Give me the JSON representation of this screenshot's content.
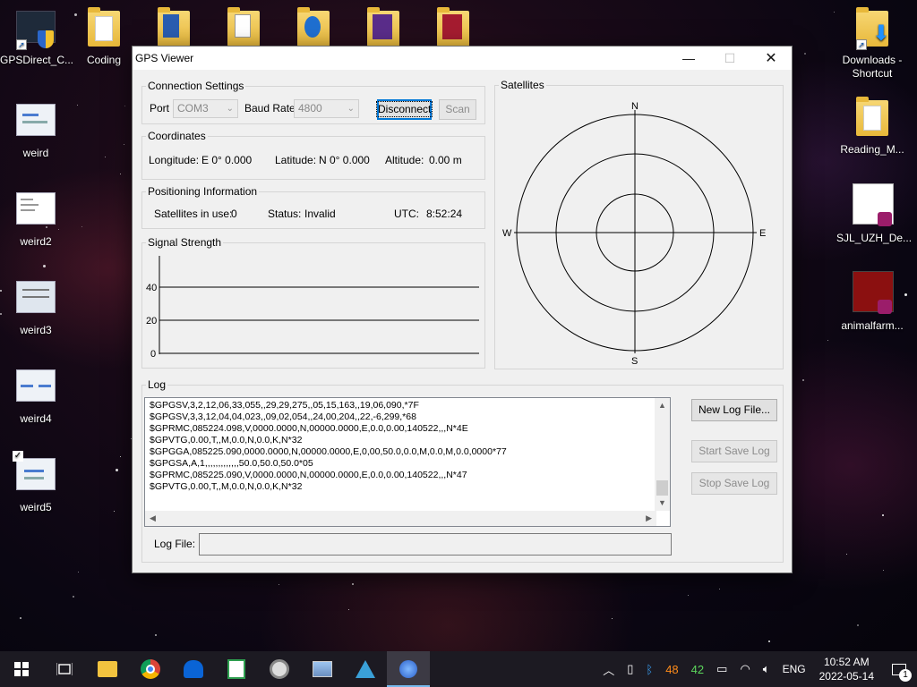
{
  "desktop": {
    "icons_left": [
      {
        "label": "GPSDirect_C...",
        "icon": "shortcut-shield-icon"
      },
      {
        "label": "weird",
        "icon": "image-thumb-icon"
      },
      {
        "label": "weird2",
        "icon": "image-thumb-icon"
      },
      {
        "label": "weird3",
        "icon": "image-thumb-icon"
      },
      {
        "label": "weird4",
        "icon": "image-thumb-icon"
      },
      {
        "label": "weird5",
        "icon": "image-thumb-icon"
      }
    ],
    "icons_top": [
      {
        "label": "Coding",
        "icon": "folder-icon"
      },
      {
        "label": "",
        "icon": "folder-icon"
      },
      {
        "label": "",
        "icon": "folder-icon"
      },
      {
        "label": "",
        "icon": "folder-icon"
      },
      {
        "label": "",
        "icon": "folder-icon"
      },
      {
        "label": "",
        "icon": "folder-icon"
      }
    ],
    "icons_right": [
      {
        "label": "Downloads - Shortcut",
        "icon": "downloads-folder-icon"
      },
      {
        "label": "Reading_M...",
        "icon": "folder-icon"
      },
      {
        "label": "SJL_UZH_De...",
        "icon": "pdf-document-icon"
      },
      {
        "label": "animalfarm...",
        "icon": "pdf-document-icon"
      }
    ]
  },
  "window": {
    "title": "GPS Viewer",
    "connection": {
      "group_label": "Connection Settings",
      "port_label": "Port",
      "port_value": "COM3",
      "baud_label": "Baud Rate",
      "baud_value": "4800",
      "disconnect_label": "Disconnect",
      "scan_label": "Scan"
    },
    "coordinates": {
      "group_label": "Coordinates",
      "longitude_label": "Longitude:",
      "longitude_value": "E 0° 0.000",
      "latitude_label": "Latitude:",
      "latitude_value": "N 0° 0.000",
      "altitude_label": "Altitude:",
      "altitude_value": "0.00 m"
    },
    "positioning": {
      "group_label": "Positioning Information",
      "sats_label": "Satellites in use:",
      "sats_value": "0",
      "status_label": "Status:",
      "status_value": "Invalid",
      "utc_label": "UTC:",
      "utc_value": "8:52:24"
    },
    "signal": {
      "group_label": "Signal Strength",
      "ticks": [
        "40",
        "20",
        "0"
      ]
    },
    "satellites": {
      "group_label": "Satellites",
      "compass": {
        "n": "N",
        "s": "S",
        "e": "E",
        "w": "W"
      }
    },
    "log": {
      "group_label": "Log",
      "lines": [
        "$GPGSV,3,2,12,06,33,055,,29,29,275,,05,15,163,,19,06,090,*7F",
        "$GPGSV,3,3,12,04,04,023,,09,02,054,,24,00,204,,22,-6,299,*68",
        "$GPRMC,085224.098,V,0000.0000,N,00000.0000,E,0.0,0.00,140522,,,N*4E",
        "$GPVTG,0.00,T,,M,0.0,N,0.0,K,N*32",
        "$GPGGA,085225.090,0000.0000,N,00000.0000,E,0,00,50.0,0.0,M,0.0,M,0.0,0000*77",
        "$GPGSA,A,1,,,,,,,,,,,,,50.0,50.0,50.0*05",
        "$GPRMC,085225.090,V,0000.0000,N,00000.0000,E,0.0,0.00,140522,,,N*47",
        "$GPVTG,0.00,T,,M,0.0,N,0.0,K,N*32"
      ],
      "new_log_label": "New Log File...",
      "start_save_label": "Start Save Log",
      "stop_save_label": "Stop Save Log",
      "logfile_label": "Log File:",
      "logfile_value": ""
    }
  },
  "taskbar": {
    "apps": [
      "start-icon",
      "task-view-icon",
      "file-explorer-icon",
      "chrome-icon",
      "outlook-icon",
      "spreadsheet-icon",
      "opensuse-icon",
      "image-viewer-icon",
      "ide-icon",
      "gps-viewer-icon"
    ],
    "tray": {
      "temp1": "48",
      "temp2": "42",
      "lang": "ENG",
      "time": "10:52 AM",
      "date": "2022-05-14",
      "notifications": "1"
    }
  },
  "colors": {
    "accent": "#0078d7",
    "temp1_color": "#ff8c1a",
    "temp2_color": "#5cd65c"
  }
}
